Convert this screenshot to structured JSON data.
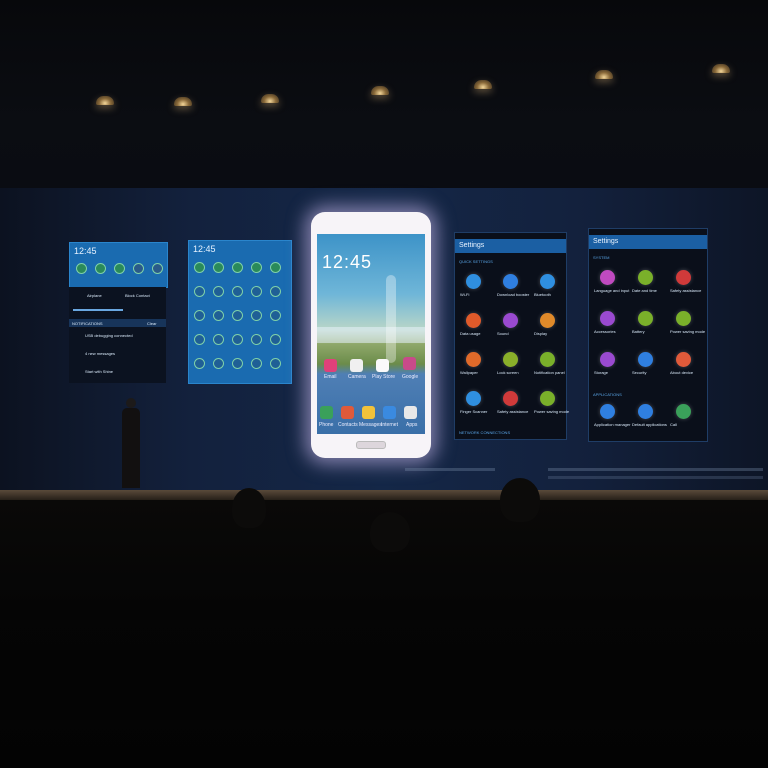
{
  "panel1": {
    "time": "12:45",
    "rows": [
      {
        "label": "Airplane",
        "value": "Block Contact"
      },
      {
        "label": "NOTIFICATIONS",
        "value": "Clear"
      },
      {
        "label": "USB debugging connected",
        "value": ""
      },
      {
        "label": "4 new messages",
        "value": ""
      },
      {
        "label": "Start with Shine",
        "value": ""
      }
    ]
  },
  "panel2": {
    "time": "12:45"
  },
  "phone": {
    "time": "12:45",
    "apps": [
      "Email",
      "Camera",
      "Play Store",
      "Google"
    ],
    "dock": [
      "Phone",
      "Contacts",
      "Messages",
      "Internet",
      "Apps"
    ]
  },
  "settings1": {
    "title": "Settings",
    "section": "QUICK SETTINGS",
    "items": [
      "Wi-Fi",
      "Download booster",
      "Bluetooth",
      "Data usage",
      "Sound",
      "Display",
      "Wallpaper",
      "Lock screen",
      "Notification panel",
      "Finger Scanner",
      "Safety assistance",
      "Power saving mode"
    ],
    "footer": "NETWORK CONNECTIONS"
  },
  "settings2": {
    "title": "Settings",
    "section": "SYSTEM",
    "items": [
      "Language and input",
      "Date and time",
      "Safety assistance",
      "Accessories",
      "Battery",
      "Power saving mode",
      "Storage",
      "Security",
      "About device"
    ],
    "section2": "APPLICATIONS",
    "items2": [
      "Application manager",
      "Default applications",
      "Call"
    ]
  },
  "colors": {
    "screen_bg": "#142747",
    "panel_blue": "#1a6bb0",
    "phone_glow": "#dcc8ff"
  }
}
